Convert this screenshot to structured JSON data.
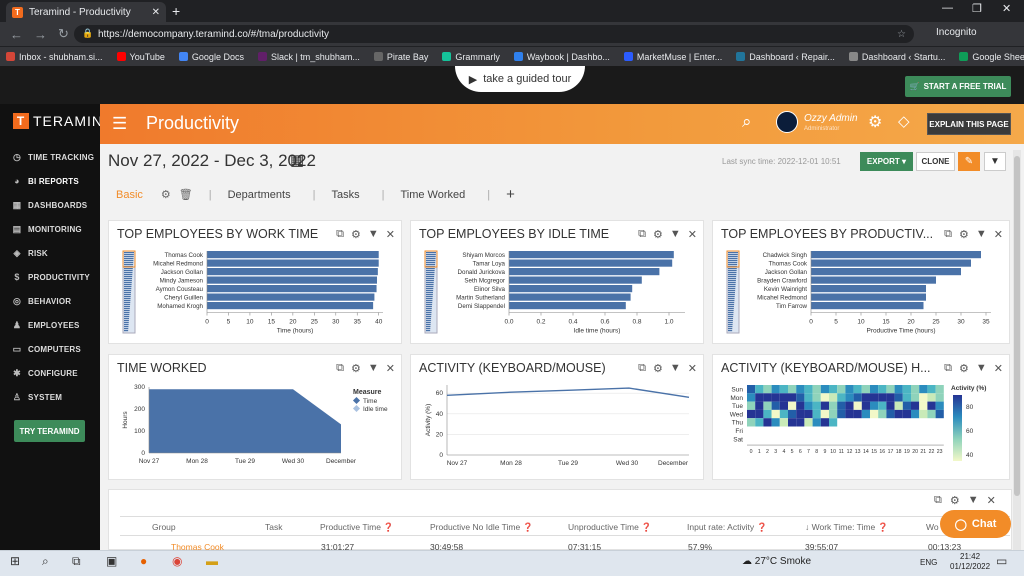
{
  "browser": {
    "tab_title": "Teramind - Productivity",
    "url": "https://democompany.teramind.co/#/tma/productivity",
    "profile": "Incognito",
    "bookmarks": [
      {
        "label": "Inbox - shubham.si...",
        "color": "#d44638"
      },
      {
        "label": "YouTube",
        "color": "#ff0000"
      },
      {
        "label": "Google Docs",
        "color": "#4285f4"
      },
      {
        "label": "Slack | tm_shubham...",
        "color": "#611f69"
      },
      {
        "label": "Pirate Bay",
        "color": "#666666"
      },
      {
        "label": "Grammarly",
        "color": "#15c39a"
      },
      {
        "label": "Waybook | Dashbo...",
        "color": "#2f80ed"
      },
      {
        "label": "MarketMuse | Enter...",
        "color": "#2b5cff"
      },
      {
        "label": "Dashboard ‹ Repair...",
        "color": "#21759b"
      },
      {
        "label": "Dashboard ‹ Startu...",
        "color": "#888888"
      },
      {
        "label": "Google Sheets",
        "color": "#0f9d58"
      }
    ]
  },
  "topbar": {
    "guided_tour": "take a guided tour",
    "trial_button": "START A FREE TRIAL"
  },
  "sidebar": {
    "logo": "TERAMIND",
    "items": [
      {
        "label": "TIME TRACKING",
        "icon": "clock-icon",
        "glyph": "◷"
      },
      {
        "label": "BI REPORTS",
        "icon": "pie-chart-icon",
        "glyph": "◕"
      },
      {
        "label": "DASHBOARDS",
        "icon": "dashboard-icon",
        "glyph": "▦"
      },
      {
        "label": "MONITORING",
        "icon": "monitor-icon",
        "glyph": "▤"
      },
      {
        "label": "RISK",
        "icon": "shield-icon",
        "glyph": "◈"
      },
      {
        "label": "PRODUCTIVITY",
        "icon": "dollar-icon",
        "glyph": "$"
      },
      {
        "label": "BEHAVIOR",
        "icon": "gamepad-icon",
        "glyph": "◎"
      },
      {
        "label": "EMPLOYEES",
        "icon": "users-icon",
        "glyph": "♟"
      },
      {
        "label": "COMPUTERS",
        "icon": "computer-icon",
        "glyph": "▭"
      },
      {
        "label": "CONFIGURE",
        "icon": "gear-icon",
        "glyph": "✱"
      },
      {
        "label": "SYSTEM",
        "icon": "user-gear-icon",
        "glyph": "♙"
      }
    ],
    "active_index": 1,
    "try_button": "TRY TERAMIND"
  },
  "header": {
    "title": "Productivity",
    "user_name": "Ozzy Admin",
    "user_role": "Administrator",
    "explain_button": "EXPLAIN THIS PAGE"
  },
  "toolbar": {
    "date_range": "Nov 27, 2022 - Dec 3, 2022",
    "last_sync": "Last sync time: 2022-12-01 10:51",
    "export": "EXPORT ▾",
    "clone": "CLONE"
  },
  "tabs": {
    "basic": "Basic",
    "departments": "Departments",
    "tasks": "Tasks",
    "time_worked": "Time Worked"
  },
  "colors": {
    "accent": "#f28c28",
    "bar": "#4a72a8",
    "green": "#3d8b5a"
  },
  "cards": {
    "top_work": "TOP EMPLOYEES BY WORK TIME",
    "top_idle": "TOP EMPLOYEES BY IDLE TIME",
    "top_prod": "TOP EMPLOYEES BY PRODUCTIV...",
    "time_worked": "TIME WORKED",
    "activity": "ACTIVITY (KEYBOARD/MOUSE)",
    "activity_heat": "ACTIVITY (KEYBOARD/MOUSE) H..."
  },
  "chart_data": [
    {
      "type": "bar",
      "orientation": "horizontal",
      "categories": [
        "Thomas Cook",
        "Micahel Redmond",
        "Jackson Gollan",
        "Mindy Jameson",
        "Aymon Cousteau",
        "Cheryl Guillen",
        "Mohamed Krogh"
      ],
      "values": [
        40,
        40,
        39.8,
        39.6,
        39.5,
        39,
        38.7
      ],
      "xlabel": "Time (hours)",
      "xticks": [
        0,
        5,
        10,
        15,
        20,
        25,
        30,
        35,
        40
      ],
      "xlim": [
        0,
        41
      ]
    },
    {
      "type": "bar",
      "orientation": "horizontal",
      "categories": [
        "Shiyam Morcos",
        "Tamar Loya",
        "Donald Jurickova",
        "Seth Mcgregor",
        "Elinor Silva",
        "Martin Sutherland",
        "Demi Slappendel"
      ],
      "values": [
        1.03,
        1.02,
        0.94,
        0.83,
        0.77,
        0.76,
        0.73
      ],
      "xlabel": "Idle time (hours)",
      "xticks": [
        "0.0",
        "0.2",
        "0.4",
        "0.6",
        "0.8",
        "1.0"
      ],
      "xlim": [
        0,
        1.1
      ]
    },
    {
      "type": "bar",
      "orientation": "horizontal",
      "categories": [
        "Chadwick Singh",
        "Thomas Cook",
        "Jackson Gollan",
        "Brayden Crawford",
        "Kevin Wainright",
        "Micahel Redmond",
        "Tim Farrow"
      ],
      "values": [
        34,
        32,
        30,
        25,
        23,
        23,
        22.5
      ],
      "xlabel": "Productive Time (hours)",
      "xticks": [
        0,
        5,
        10,
        15,
        20,
        25,
        30,
        35
      ],
      "xlim": [
        0,
        36
      ]
    },
    {
      "type": "area",
      "x": [
        "Nov 27",
        "Mon 28",
        "Tue 29",
        "Wed 30",
        "December"
      ],
      "values": [
        290,
        290,
        290,
        290,
        130
      ],
      "ylabel": "Hours",
      "yticks": [
        0,
        100,
        200,
        300
      ],
      "ylim": [
        0,
        300
      ],
      "legend_title": "Measure",
      "legend": [
        "Time",
        "Idle time"
      ]
    },
    {
      "type": "line",
      "x": [
        "Nov 27",
        "Mon 28",
        "Tue 29",
        "Wed 30",
        "December"
      ],
      "values": [
        58,
        61,
        63,
        65,
        56
      ],
      "ylabel": "Activity (%)",
      "yticks": [
        0,
        20,
        40,
        60
      ],
      "ylim": [
        0,
        68
      ]
    },
    {
      "type": "heatmap",
      "rows": [
        "Sun",
        "Mon",
        "Tue",
        "Wed",
        "Thu",
        "Fri",
        "Sat"
      ],
      "columns": [
        "0",
        "1",
        "2",
        "3",
        "4",
        "5",
        "6",
        "7",
        "8",
        "9",
        "10",
        "11",
        "12",
        "13",
        "14",
        "15",
        "16",
        "17",
        "18",
        "19",
        "20",
        "21",
        "22",
        "23"
      ],
      "legend_title": "Activity (%)",
      "legend_ticks": [
        40,
        60,
        80
      ],
      "range": [
        35,
        90
      ]
    }
  ],
  "grid": {
    "headers": [
      "Group",
      "Task",
      "Productive Time ❓",
      "Productive No Idle Time ❓",
      "Unproductive Time ❓",
      "Input rate: Activity ❓",
      "↓ Work Time: Time ❓",
      "Wo"
    ],
    "row": [
      "Thomas Cook",
      "",
      "31:01:27",
      "30:49:58",
      "07:31:15",
      "57.9%",
      "39:55:07",
      "00:13:23"
    ],
    "chat": "Chat"
  },
  "taskbar": {
    "weather": "27°C Smoke",
    "lang": "ENG",
    "time": "21:42",
    "date": "01/12/2022"
  }
}
